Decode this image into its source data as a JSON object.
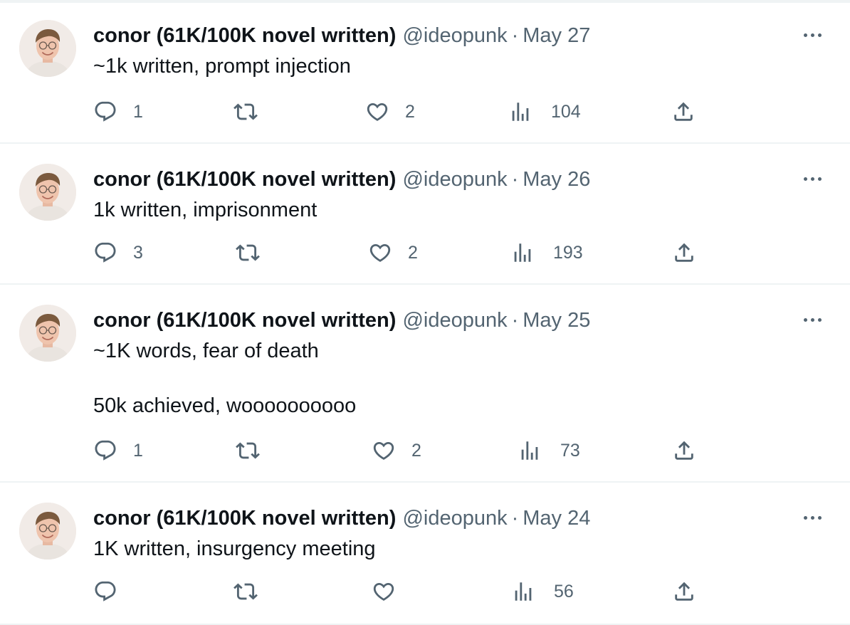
{
  "tweets": [
    {
      "author": "conor (61K/100K novel written)",
      "handle": "@ideopunk",
      "separator": "·",
      "date": "May 27",
      "text": "~1k written, prompt injection",
      "text_line2": "",
      "replies": "1",
      "retweets": "",
      "likes": "2",
      "views": "104"
    },
    {
      "author": "conor (61K/100K novel written)",
      "handle": "@ideopunk",
      "separator": "·",
      "date": "May 26",
      "text": "1k written, imprisonment",
      "text_line2": "",
      "replies": "3",
      "retweets": "",
      "likes": "2",
      "views": "193"
    },
    {
      "author": "conor (61K/100K novel written)",
      "handle": "@ideopunk",
      "separator": "·",
      "date": "May 25",
      "text": "~1K words, fear of death",
      "text_line2": "50k achieved, woooooooooo",
      "replies": "1",
      "retweets": "",
      "likes": "2",
      "views": "73"
    },
    {
      "author": "conor (61K/100K novel written)",
      "handle": "@ideopunk",
      "separator": "·",
      "date": "May 24",
      "text": "1K written, insurgency meeting",
      "text_line2": "",
      "replies": "",
      "retweets": "",
      "likes": "",
      "views": "56"
    }
  ],
  "icons": {
    "reply": "reply-icon",
    "retweet": "retweet-icon",
    "like": "like-icon",
    "views": "views-icon",
    "share": "share-icon",
    "more": "more-icon"
  },
  "colors": {
    "text": "#0f1419",
    "secondary": "#536471",
    "divider": "#eff3f4"
  }
}
